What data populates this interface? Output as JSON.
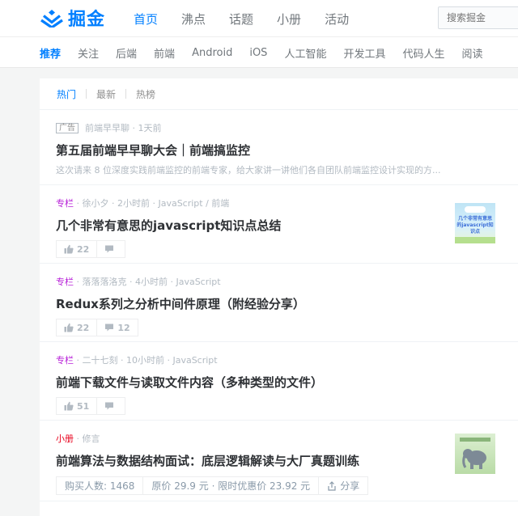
{
  "header": {
    "logo_text": "掘金",
    "nav": [
      {
        "label": "首页",
        "active": true
      },
      {
        "label": "沸点",
        "active": false
      },
      {
        "label": "话题",
        "active": false
      },
      {
        "label": "小册",
        "active": false
      },
      {
        "label": "活动",
        "active": false
      }
    ],
    "search_placeholder": "搜索掘金"
  },
  "categories": [
    "推荐",
    "关注",
    "后端",
    "前端",
    "Android",
    "iOS",
    "人工智能",
    "开发工具",
    "代码人生",
    "阅读"
  ],
  "tabs": [
    "热门",
    "最新",
    "热榜"
  ],
  "entries": [
    {
      "tag": "广告",
      "meta": "前端早早聊 · 1天前",
      "title": "第五届前端早早聊大会｜前端搞监控",
      "desc": "这次请来 8 位深度实践前端监控的前端专家，给大家讲一讲他们各自团队前端监控设计实现的方..."
    },
    {
      "tag": "专栏",
      "meta": " · 徐小夕 · 2小时前 · JavaScript / 前端",
      "title": "几个非常有意思的javascript知识点总结",
      "likes": "22",
      "comments": "",
      "thumb_text": "几个非常有意思的javascript知识点"
    },
    {
      "tag": "专栏",
      "meta": " · 落落落洛克 · 4小时前 · JavaScript",
      "title": "Redux系列之分析中间件原理（附经验分享）",
      "likes": "22",
      "comments": "12"
    },
    {
      "tag": "专栏",
      "meta": " · 二十七刻 · 10小时前 · JavaScript",
      "title": "前端下载文件与读取文件内容（多种类型的文件）",
      "likes": "51",
      "comments": ""
    },
    {
      "tag": "小册",
      "meta": " · 修言",
      "title": "前端算法与数据结构面试：底层逻辑解读与大厂真题训练",
      "buyers": "购买人数: 1468",
      "price": "原价 29.9 元 · 限时优惠价 23.92 元",
      "share": "分享"
    }
  ],
  "colors": {
    "brand": "#007fff",
    "column_tag": "#b71ed7",
    "book_tag": "#e8001c"
  }
}
